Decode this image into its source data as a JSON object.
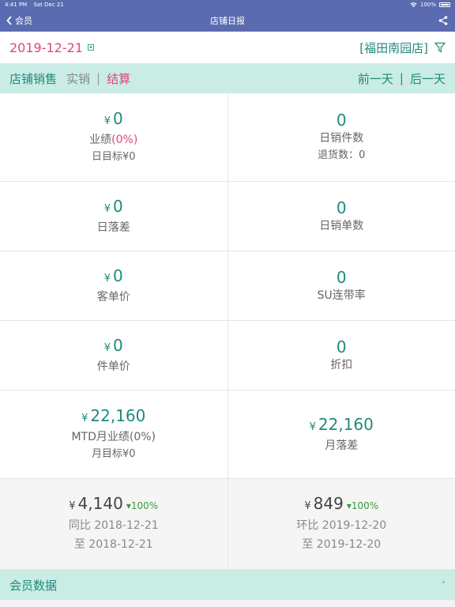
{
  "status": {
    "time": "4:41 PM",
    "date": "Sat Dec 21",
    "battery": "100%"
  },
  "nav": {
    "back_label": "会员",
    "title": "店铺日报"
  },
  "header": {
    "date": "2019-12-21",
    "store": "[福田南园店]"
  },
  "tabs": {
    "items": [
      "店铺销售",
      "实销",
      "结算"
    ],
    "sep": "|"
  },
  "day_nav": {
    "prev": "前一天",
    "sep": "|",
    "next": "后一天"
  },
  "metrics": {
    "yen": "¥",
    "performance": {
      "value": "0",
      "label": "业绩",
      "pct_open": "(",
      "pct": "0%",
      "pct_close": ")",
      "target_label": "日目标",
      "target_value": "¥0"
    },
    "daily_items": {
      "value": "0",
      "label": "日销件数",
      "returns_label": "退货数：",
      "returns_value": "0"
    },
    "daily_gap": {
      "value": "0",
      "label": "日落差"
    },
    "daily_orders": {
      "value": "0",
      "label": "日销单数"
    },
    "avg_customer_price": {
      "value": "0",
      "label": "客单价"
    },
    "su_rate": {
      "value": "0",
      "label": "SU连带率"
    },
    "avg_item_price": {
      "value": "0",
      "label": "件单价"
    },
    "discount": {
      "value": "0",
      "label": "折扣"
    },
    "mtd": {
      "value": "22,160",
      "label": "MTD月业绩",
      "pct": "(0%)",
      "target_label": "月目标",
      "target_value": "¥0"
    },
    "month_gap": {
      "value": "22,160",
      "label": "月落差"
    },
    "yoy": {
      "value": "4,140",
      "change": "▾100%",
      "compare_label": "同比",
      "compare_date": "2018-12-21",
      "to_label": "至",
      "to_date": "2018-12-21"
    },
    "mom": {
      "value": "849",
      "change": "▾100%",
      "compare_label": "环比",
      "compare_date": "2019-12-20",
      "to_label": "至",
      "to_date": "2019-12-20"
    }
  },
  "member_section": {
    "title": "会员数据",
    "chevron": "˄"
  },
  "colors": {
    "nav": "#5b6bb0",
    "accent": "#1f8a7b",
    "pink": "#e0457b",
    "tab_bg": "#c9ece5",
    "up": "#3a9a3a"
  }
}
